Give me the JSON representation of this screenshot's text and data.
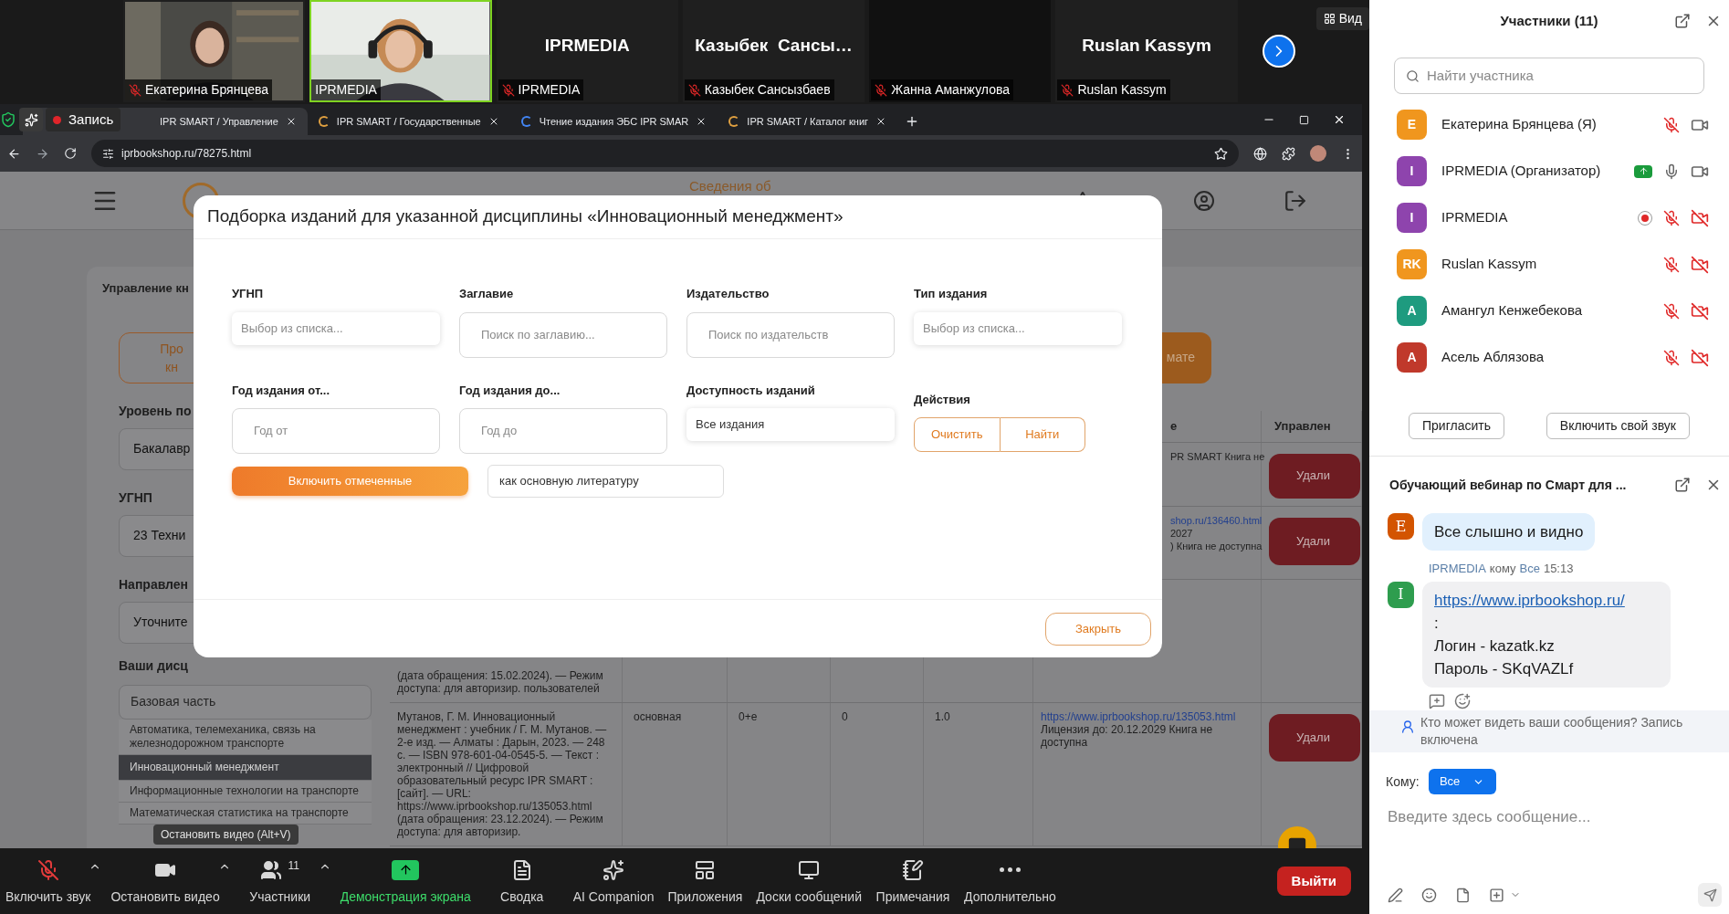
{
  "video_strip": {
    "tiles": [
      {
        "label": "Екатерина Брянцева",
        "muted": true,
        "active": false
      },
      {
        "label": "IPRMEDIA",
        "muted": false,
        "active": true
      },
      {
        "kind": "name",
        "display_name": "IPRMEDIA",
        "label": "IPRMEDIA",
        "muted": true,
        "active": false
      },
      {
        "kind": "name",
        "display_name": "Казыбек  Сансы…",
        "label": "Казыбек Сансызбаев",
        "muted": true,
        "active": false
      },
      {
        "kind": "blank",
        "label": "Жанна Аманжулова",
        "muted": true,
        "active": false
      },
      {
        "kind": "name",
        "display_name": "Ruslan Kassym",
        "label": "Ruslan Kassym",
        "muted": true,
        "active": false
      }
    ],
    "view_button": "Вид"
  },
  "recording": "Запись",
  "browser": {
    "tabs": [
      {
        "title": "IPR SMART / Управление",
        "selected": true
      },
      {
        "title": "IPR SMART / Государственные",
        "selected": false
      },
      {
        "title": "Чтение издания ЭБС IPR SMAR",
        "selected": false
      },
      {
        "title": "IPR SMART / Каталог книг",
        "selected": false
      }
    ],
    "address": "iprbookshop.ru/78275.html"
  },
  "page": {
    "header_link": "Сведения об",
    "card_title": "Управление кн",
    "outline_button": "Про кн",
    "fields": [
      {
        "label": "Уровень по",
        "value": "Бакалавр"
      },
      {
        "label": "УГНП",
        "value": "23 Техни"
      },
      {
        "label": "Направлен",
        "value": "Уточните"
      }
    ],
    "disciplines_label": "Ваши дисц",
    "disciplines_group": "Базовая часть",
    "disciplines": [
      {
        "name": "Автоматика, телемеханика, связь на железнодорожном транспорте",
        "selected": false
      },
      {
        "name": "Инновационный менеджмент",
        "selected": true
      },
      {
        "name": "Информационные технологии на транспорте",
        "selected": false
      },
      {
        "name": "Математическая статистика на транспорте",
        "selected": false
      }
    ],
    "filled_button": "мате",
    "table": {
      "columns": [
        {
          "label": "е"
        },
        {
          "label": "Управлен"
        }
      ],
      "rows": [
        {
          "column_6": {
            "text": "PR SMART Книга не"
          },
          "column_7": "Удали"
        },
        {
          "column_6": {
            "link": "shop.ru/136460.html",
            "text": "2027\n) Книга не доступна"
          },
          "column_7": "Удали"
        },
        {
          "column_1": "(дата обращения: 15.02.2024). — Режим доступа: для авторизир. пользователей"
        },
        {
          "column_1": "Мутанов, Г. М. Инновационный менеджмент : учебник / Г. М. Мутанов. — 2-е изд. — Алматы : Дарын, 2023. — 248 с. — ISBN 978-601-04-0545-5. — Текст : электронный // Цифровой образовательный ресурс IPR SMART : [сайт]. — URL: https://www.iprbookshop.ru/135053.html (дата обращения: 23.12.2024). — Режим доступа: для авторизир.",
          "column_2": "основная",
          "column_3": "0+е",
          "column_4": "0",
          "column_5": "1.0",
          "column_6": {
            "link": "https://www.iprbookshop.ru/135053.html",
            "text": "Лицензия до: 20.12.2029 Книга не доступна"
          },
          "column_7": "Удали"
        }
      ]
    }
  },
  "modal": {
    "title": "Подборка изданий для указанной дисциплины «Инновационный менеджмент»",
    "filters": [
      {
        "kind": "select",
        "label": "УГНП",
        "placeholder": "Выбор из списка..."
      },
      {
        "kind": "text",
        "label": "Заглавие",
        "placeholder": "Поиск по заглавию..."
      },
      {
        "kind": "text",
        "label": "Издательство",
        "placeholder": "Поиск по издательств"
      },
      {
        "kind": "select",
        "label": "Тип издания",
        "placeholder": "Выбор из списка..."
      },
      {
        "kind": "text",
        "label": "Год издания от...",
        "placeholder": "Год от"
      },
      {
        "kind": "text",
        "label": "Год издания до...",
        "placeholder": "Год до"
      },
      {
        "kind": "select",
        "label": "Доступность изданий",
        "value": "Все издания"
      }
    ],
    "actions_label": "Действия",
    "actions": [
      "Очистить",
      "Найти"
    ],
    "include_button": "Включить отмеченные",
    "literature_select": "как основную литературу",
    "close_button": "Закрыть"
  },
  "toolbar": {
    "items": [
      {
        "kind": "mic",
        "label": "Включить звук",
        "caret": true
      },
      {
        "kind": "video",
        "label": "Остановить видео",
        "caret": true
      },
      {
        "kind": "participants",
        "label": "Участники",
        "count": "11",
        "caret": true
      },
      {
        "kind": "share",
        "label": "Демонстрация экрана",
        "caret": false
      },
      {
        "kind": "summary",
        "label": "Сводка",
        "caret": false
      },
      {
        "kind": "ai",
        "label": "AI Companion",
        "caret": false
      },
      {
        "kind": "apps",
        "label": "Приложения",
        "caret": false
      },
      {
        "kind": "boards",
        "label": "Доски сообщений",
        "caret": false
      },
      {
        "kind": "notes",
        "label": "Примечания",
        "caret": false
      },
      {
        "kind": "more",
        "label": "Дополнительно",
        "caret": false
      }
    ],
    "tooltip": "Остановить видео (Alt+V)",
    "leave_button": "Выйти"
  },
  "participants": {
    "title": "Участники (11)",
    "search_placeholder": "Найти участника",
    "list": [
      {
        "initials": "E",
        "name": "Екатерина Брянцева (Я)",
        "color": "#f0961e",
        "muted": true,
        "video_off": false,
        "sharing": false,
        "recording": false
      },
      {
        "initials": "I",
        "name": "IPRMEDIA (Организатор)",
        "color": "#8e44ad",
        "muted": false,
        "video_off": false,
        "sharing": true,
        "recording": false
      },
      {
        "initials": "I",
        "name": "IPRMEDIA",
        "color": "#8e44ad",
        "muted": true,
        "video_off": true,
        "sharing": false,
        "recording": true
      },
      {
        "initials": "RK",
        "name": "Ruslan Kassym",
        "color": "#f0961e",
        "muted": true,
        "video_off": true,
        "sharing": false,
        "recording": false
      },
      {
        "initials": "A",
        "name": "Амангул Кенжебекова",
        "color": "#1e9b7f",
        "muted": true,
        "video_off": true,
        "sharing": false,
        "recording": false
      },
      {
        "initials": "A",
        "name": "Асель Аблязова",
        "color": "#c0392b",
        "muted": true,
        "video_off": true,
        "sharing": false,
        "recording": false
      }
    ],
    "buttons": [
      "Пригласить",
      "Включить свой звук"
    ]
  },
  "chat": {
    "title": "Обучающий вебинар по Смарт для ...",
    "messages": [
      {
        "kind": "plain",
        "avatar": "E",
        "color": "#d35400",
        "lines": [
          "Все слышно и видно"
        ]
      },
      {
        "kind": "meta",
        "avatar": "I",
        "color": "#2e9d4e",
        "sender": "IPRMEDIA",
        "to_word": "кому",
        "recipient": "Все",
        "time": "15:13",
        "link": "https://www.iprbookshop.ru/",
        "lines": [
          ":",
          "Логин - kazatk.kz",
          "Пароль - SKqVAZLf"
        ]
      }
    ],
    "notice": "Кто может видеть ваши сообщения? Запись включена",
    "to_label": "Кому:",
    "recipient": "Все",
    "placeholder": "Введите здесь сообщение..."
  }
}
